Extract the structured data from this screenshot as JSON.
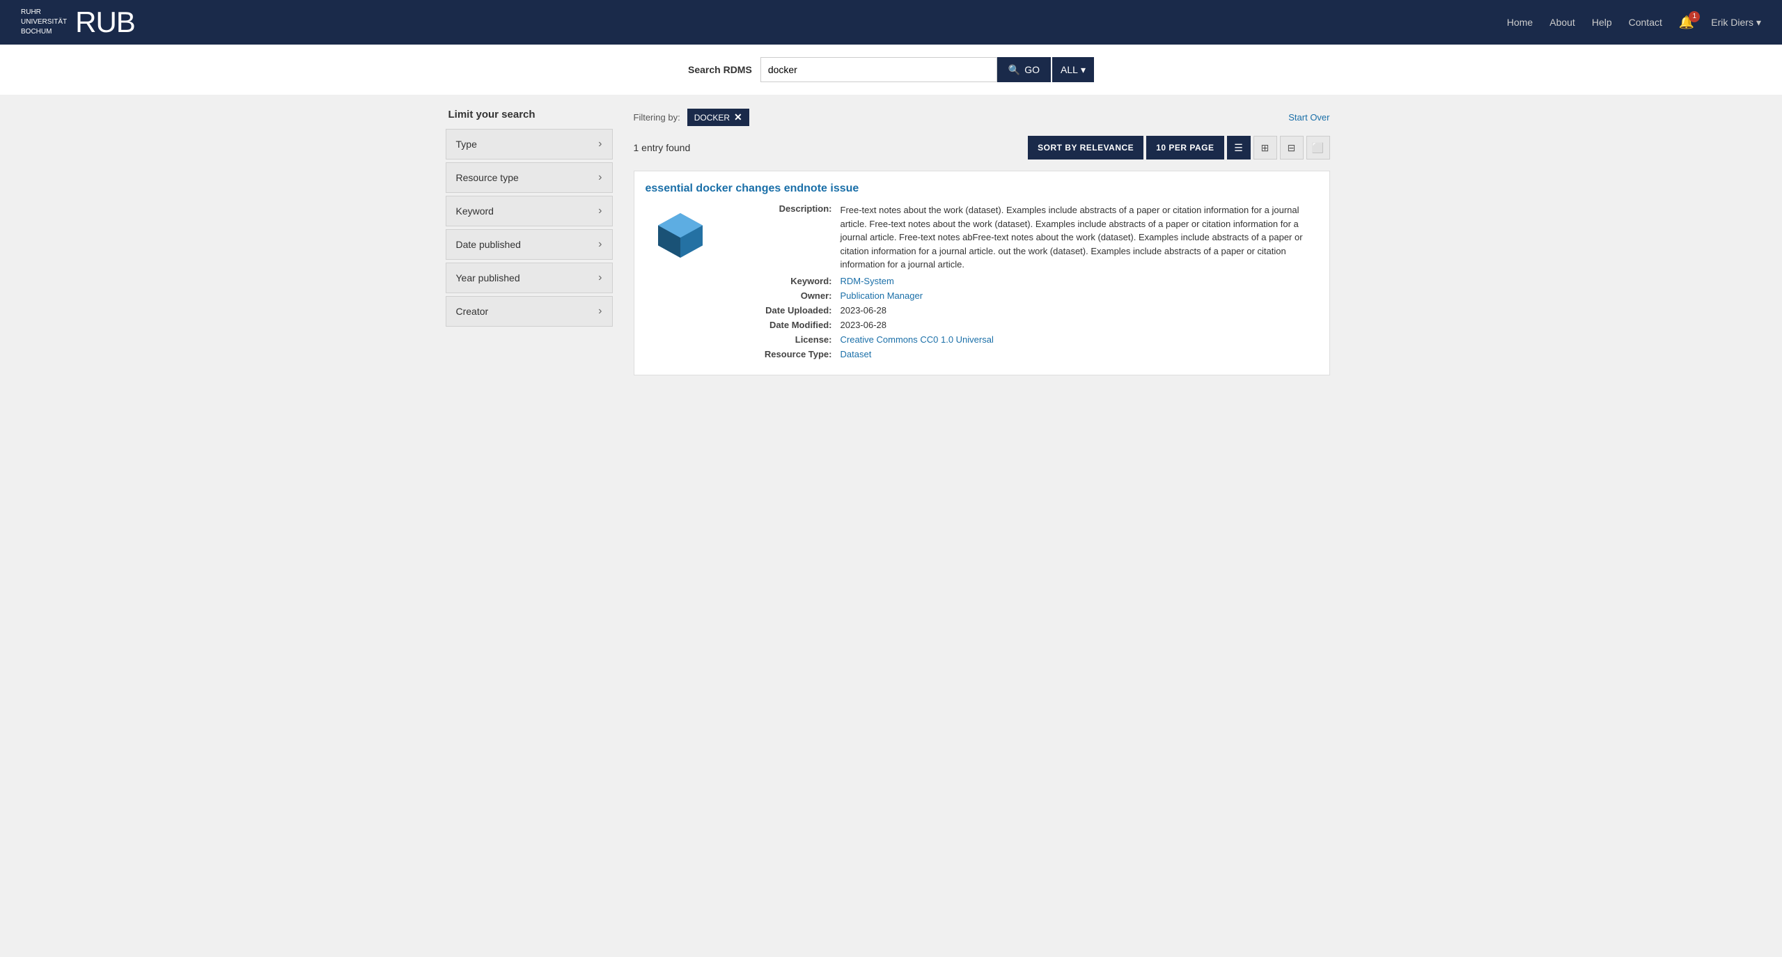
{
  "header": {
    "logo_line1": "RUHR",
    "logo_line2": "UNIVERSITÄT",
    "logo_line3": "BOCHUM",
    "logo_rub": "RUB",
    "nav": {
      "home": "Home",
      "about": "About",
      "help": "Help",
      "contact": "Contact"
    },
    "notification_count": "1",
    "user_name": "Erik Diers"
  },
  "search_bar": {
    "label": "Search RDMS",
    "query": "docker",
    "go_label": "GO",
    "all_label": "ALL"
  },
  "sidebar": {
    "title": "Limit your search",
    "facets": [
      {
        "label": "Type"
      },
      {
        "label": "Resource type"
      },
      {
        "label": "Keyword"
      },
      {
        "label": "Date published"
      },
      {
        "label": "Year published"
      },
      {
        "label": "Creator"
      }
    ]
  },
  "filter_bar": {
    "filtering_by": "Filtering by:",
    "active_filter": "DOCKER",
    "start_over": "Start Over"
  },
  "results_toolbar": {
    "count": "1 entry found",
    "sort_label": "SORT BY RELEVANCE",
    "per_page_label": "10 PER PAGE",
    "view_icons": [
      "list",
      "grid",
      "gallery",
      "slideshow"
    ]
  },
  "result": {
    "title": "essential docker changes endnote issue",
    "description": "Free-text notes about the work (dataset). Examples include abstracts of a paper or citation information for a journal article. Free-text notes about the work (dataset). Examples include abstracts of a paper or citation information for a journal article. Free-text notes abFree-text notes about the work (dataset). Examples include abstracts of a paper or citation information for a journal article. out the work (dataset). Examples include abstracts of a paper or citation information for a journal article.",
    "keyword_label": "Keyword:",
    "keyword_value": "RDM-System",
    "owner_label": "Owner:",
    "owner_value": "Publication Manager",
    "date_uploaded_label": "Date Uploaded:",
    "date_uploaded_value": "2023-06-28",
    "date_modified_label": "Date Modified:",
    "date_modified_value": "2023-06-28",
    "license_label": "License:",
    "license_value": "Creative Commons CC0 1.0 Universal",
    "resource_type_label": "Resource Type:",
    "resource_type_value": "Dataset",
    "description_label": "Description:"
  },
  "footer": {
    "pagination_label": "Publication Manager"
  },
  "colors": {
    "header_bg": "#1a2a4a",
    "link_blue": "#1a6fa8",
    "filter_tag_bg": "#1a2a4a",
    "cube_blue": "#2980b9",
    "cube_dark": "#1a5276",
    "cube_light": "#5dade2"
  }
}
